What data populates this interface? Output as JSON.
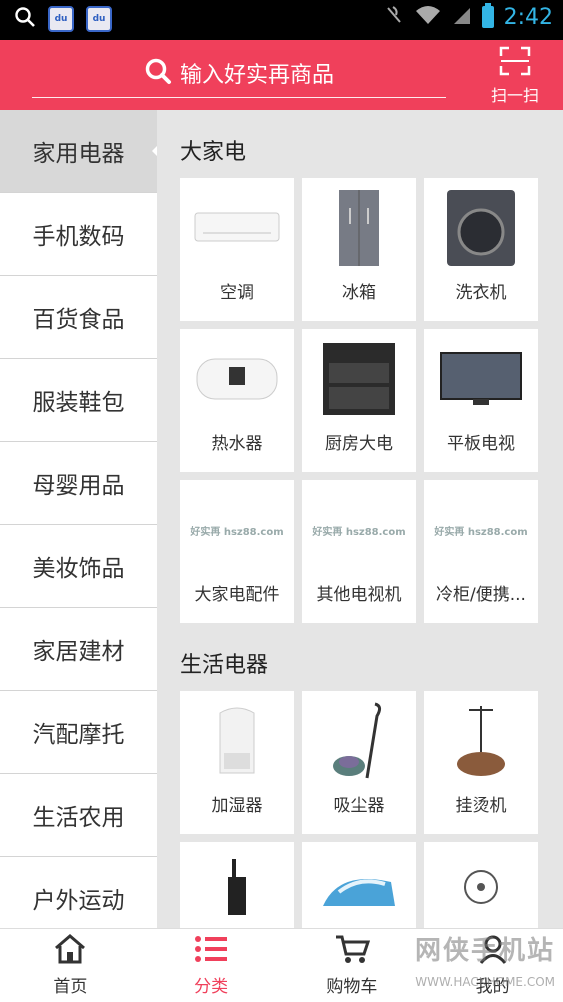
{
  "status_bar": {
    "time": "2:42",
    "app_badge_1": "du",
    "app_badge_2": "du"
  },
  "header": {
    "search_placeholder": "输入好实再商品",
    "scan_label": "扫一扫"
  },
  "sidebar": {
    "items": [
      {
        "label": "家用电器",
        "active": true
      },
      {
        "label": "手机数码"
      },
      {
        "label": "百货食品"
      },
      {
        "label": "服装鞋包"
      },
      {
        "label": "母婴用品"
      },
      {
        "label": "美妆饰品"
      },
      {
        "label": "家居建材"
      },
      {
        "label": "汽配摩托"
      },
      {
        "label": "生活农用"
      },
      {
        "label": "户外运动"
      }
    ]
  },
  "sections": [
    {
      "title": "大家电",
      "items": [
        {
          "label": "空调",
          "icon": "air-conditioner"
        },
        {
          "label": "冰箱",
          "icon": "refrigerator"
        },
        {
          "label": "洗衣机",
          "icon": "washing-machine"
        },
        {
          "label": "热水器",
          "icon": "water-heater"
        },
        {
          "label": "厨房大电",
          "icon": "kitchen-appliance"
        },
        {
          "label": "平板电视",
          "icon": "flat-tv"
        },
        {
          "label": "大家电配件",
          "icon": "placeholder-logo",
          "logo_text": "好实再 hsz88.com"
        },
        {
          "label": "其他电视机",
          "icon": "placeholder-logo",
          "logo_text": "好实再 hsz88.com"
        },
        {
          "label": "冷柜/便携...",
          "icon": "placeholder-logo",
          "logo_text": "好实再 hsz88.com"
        }
      ]
    },
    {
      "title": "生活电器",
      "items": [
        {
          "label": "加湿器",
          "icon": "humidifier"
        },
        {
          "label": "吸尘器",
          "icon": "vacuum-cleaner"
        },
        {
          "label": "挂烫机",
          "icon": "garment-steamer"
        },
        {
          "label": "",
          "icon": "walkie-talkie"
        },
        {
          "label": "",
          "icon": "iron"
        },
        {
          "label": "",
          "icon": "fan"
        }
      ]
    }
  ],
  "bottom_nav": [
    {
      "label": "首页",
      "icon": "home-icon"
    },
    {
      "label": "分类",
      "icon": "list-icon",
      "active": true
    },
    {
      "label": "购物车",
      "icon": "cart-icon"
    },
    {
      "label": "我的",
      "icon": "user-icon"
    }
  ],
  "watermark": {
    "text": "网侠手机站",
    "sub": "WWW.HACKHOME.COM"
  },
  "colors": {
    "accent": "#f0405b",
    "status_time": "#33b5e5"
  }
}
